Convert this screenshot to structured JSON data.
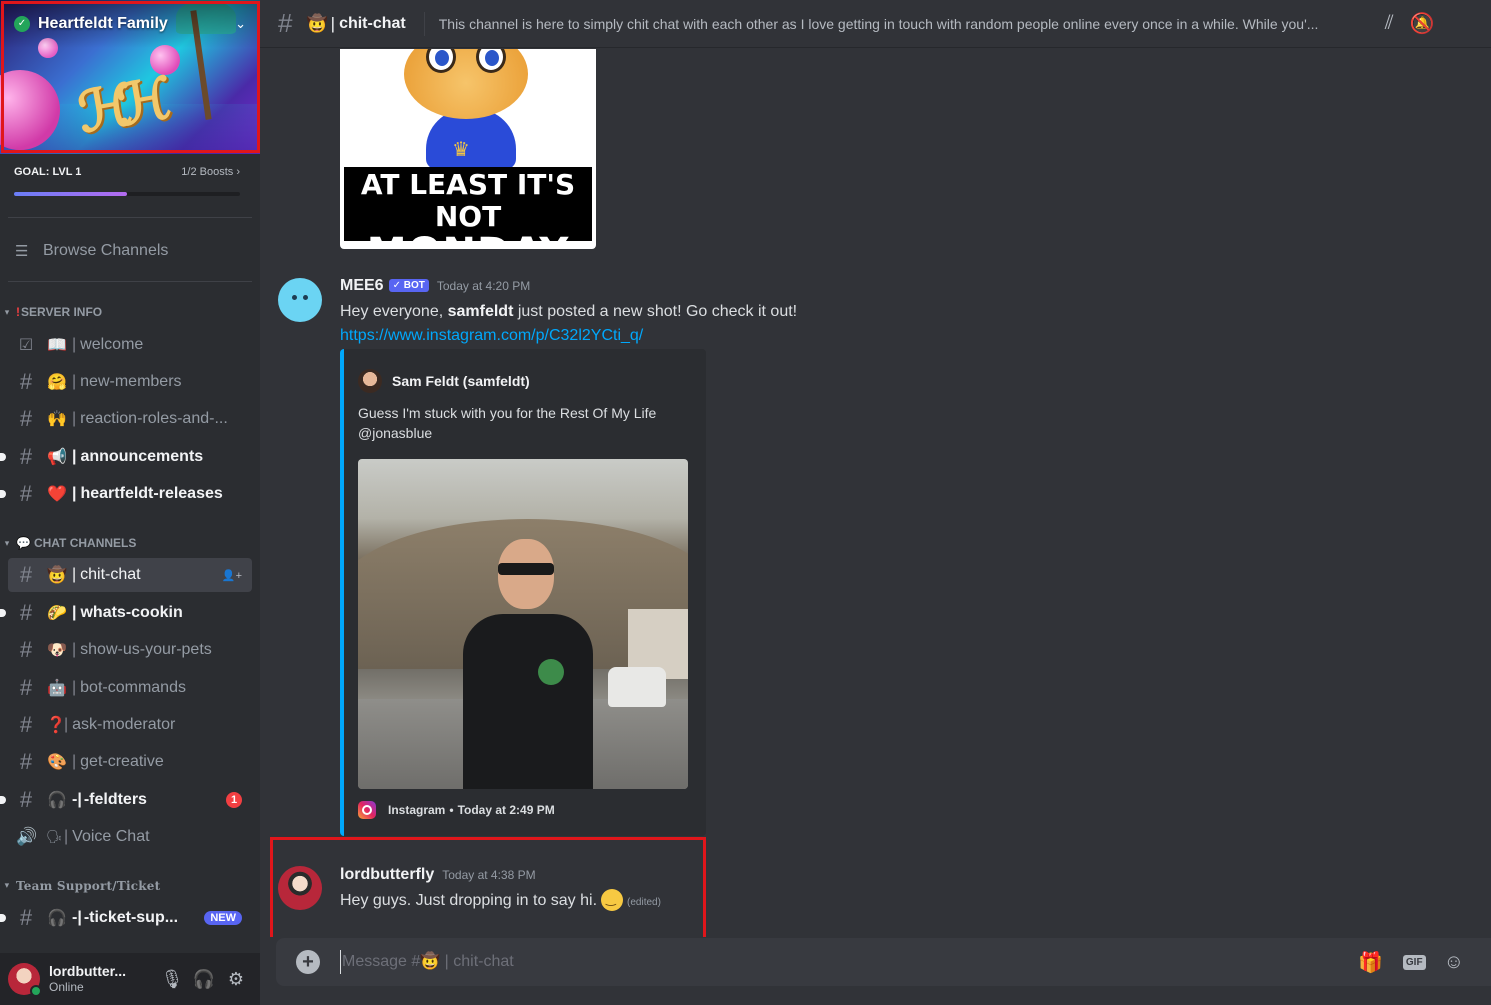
{
  "server": {
    "name": "Heartfeldt Family",
    "goal_title": "GOAL: LVL 1",
    "goal_boosts": "1/2 Boosts",
    "goal_progress": 0.5
  },
  "sidebar": {
    "browse_label": "Browse Channels",
    "categories": [
      {
        "name": "SERVER INFO",
        "prefix": "!"
      },
      {
        "name": "CHAT CHANNELS",
        "prefix": "💬"
      },
      {
        "name": "Team Support/Ticket",
        "prefix": ""
      }
    ],
    "channels": [
      {
        "emoji": "📖",
        "name": "welcome",
        "icon": "rules-checkbox-icon"
      },
      {
        "emoji": "🤗",
        "name": "new-members",
        "icon": "hash-icon"
      },
      {
        "emoji": "🙌",
        "name": "reaction-roles-and-...",
        "icon": "hash-icon"
      },
      {
        "emoji": "📢",
        "name": "announcements",
        "icon": "hash-icon"
      },
      {
        "emoji": "❤️",
        "name": "heartfeldt-releases",
        "icon": "hash-icon"
      },
      {
        "emoji": "🤠",
        "name": "chit-chat",
        "icon": "hash-icon"
      },
      {
        "emoji": "🌮",
        "name": "whats-cookin",
        "icon": "hash-icon"
      },
      {
        "emoji": "🐶",
        "name": "show-us-your-pets",
        "icon": "hash-icon"
      },
      {
        "emoji": "🤖",
        "name": "bot-commands",
        "icon": "hash-icon"
      },
      {
        "emoji": "❓",
        "name": "ask-moderator",
        "icon": "hash-icon"
      },
      {
        "emoji": "🎨",
        "name": "get-creative",
        "icon": "hash-icon"
      },
      {
        "emoji": "🎧",
        "name": "-feldters",
        "icon": "hash-icon",
        "mentions": "1"
      },
      {
        "emoji": "🗣",
        "name": "Voice Chat",
        "icon": "speaker-icon"
      },
      {
        "emoji": "🎧",
        "name": "-ticket-sup...",
        "icon": "hash-icon",
        "badge": "NEW"
      }
    ]
  },
  "user": {
    "name": "lordbutter...",
    "status": "Online"
  },
  "channel": {
    "emoji": "🤠",
    "name": "chit-chat",
    "topic": "This channel is here to simply chit chat with each other as I love getting in touch with random people online every once in a while. While you'..."
  },
  "meme": {
    "line1": "AT LEAST IT'S NOT",
    "line2": "MONDAY"
  },
  "messages": [
    {
      "author": "MEE6",
      "bot_tag": "✓ BOT",
      "timestamp": "Today at 4:20 PM",
      "text_before": "Hey everyone, ",
      "text_bold": "samfeldt",
      "text_after": " just posted a new shot! Go check it out!",
      "link": "https://www.instagram.com/p/C32l2YCti_q/",
      "embed": {
        "author": "Sam Feldt (samfeldt)",
        "description": "Guess I'm stuck with you for the Rest Of My Life @jonasblue",
        "footer_source": "Instagram",
        "footer_time": "Today at 2:49 PM"
      }
    },
    {
      "author": "lordbutterfly",
      "timestamp": "Today at 4:38 PM",
      "text": "Hey guys. Just dropping in to say hi.",
      "edited": "(edited)"
    }
  ],
  "composer": {
    "placeholder": "Message #🤠 | chit-chat"
  }
}
